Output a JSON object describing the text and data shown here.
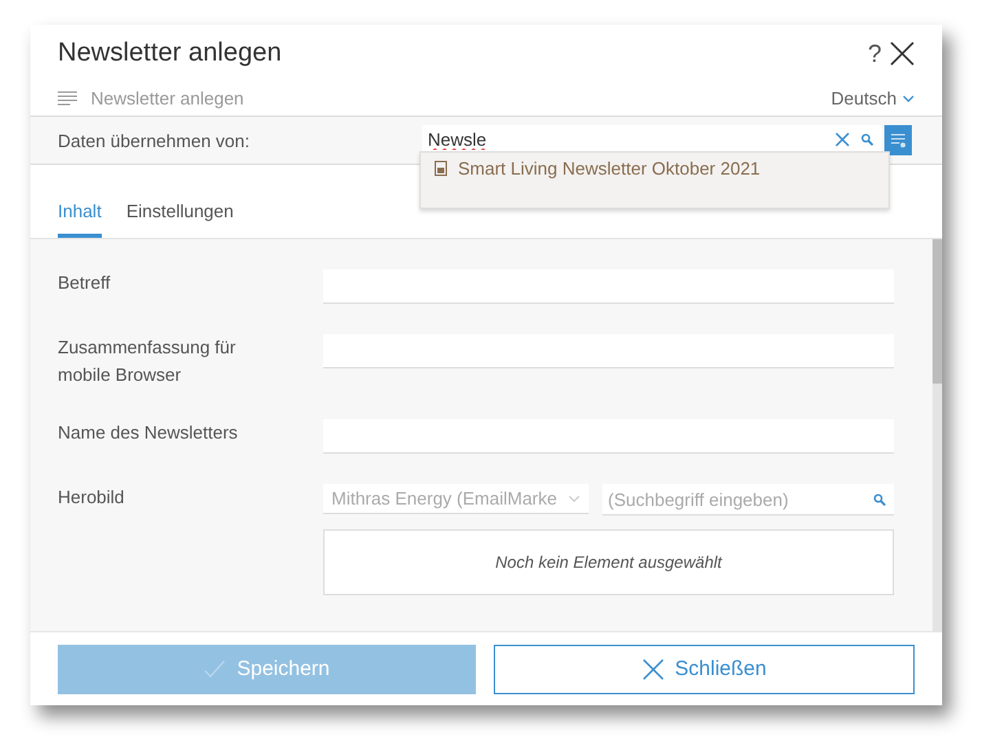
{
  "dialog": {
    "title": "Newsletter anlegen",
    "help": "?",
    "subtitle": "Newsletter anlegen",
    "language": "Deutsch"
  },
  "import": {
    "label": "Daten übernehmen von:",
    "value": "Newsle",
    "suggestions": [
      "Smart Living Newsletter Oktober 2021"
    ]
  },
  "tabs": [
    {
      "label": "Inhalt",
      "selected": true
    },
    {
      "label": "Einstellungen",
      "selected": false
    }
  ],
  "fields": [
    {
      "kind": "text",
      "label": "Betreff"
    },
    {
      "kind": "text",
      "label": "Zusammenfassung für mobile Browser"
    },
    {
      "kind": "text",
      "label": "Name des Newsletters"
    },
    {
      "kind": "image",
      "label": "Herobild",
      "source": "Mithras Energy (EmailMarke",
      "placeholder": "(Suchbegriff eingeben)",
      "empty": "Noch kein Element ausgewählt"
    }
  ],
  "buttons": [
    {
      "kind": "primary",
      "label": "Speichern",
      "disabled": true
    },
    {
      "kind": "secondary",
      "label": "Schließen",
      "disabled": false
    }
  ]
}
